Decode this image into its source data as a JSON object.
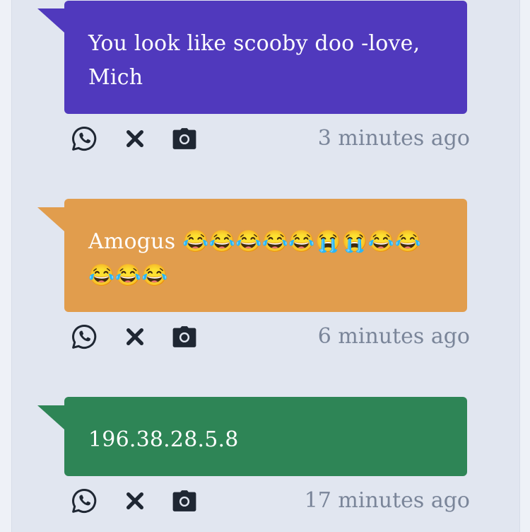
{
  "posts": [
    {
      "message": "You look like scooby doo -love, Mich",
      "time": "3 minutes ago",
      "color": "#5039bd"
    },
    {
      "message": "Amogus 😂😂😂😂😂😭😭😂😂😂😂😂",
      "time": "6 minutes ago",
      "color": "#e19d4d"
    },
    {
      "message": "196.38.28.5.8",
      "time": "17 minutes ago",
      "color": "#2e8556"
    }
  ],
  "icons": {
    "share": "whatsapp-icon",
    "delete": "close-icon",
    "screenshot": "camera-icon"
  }
}
